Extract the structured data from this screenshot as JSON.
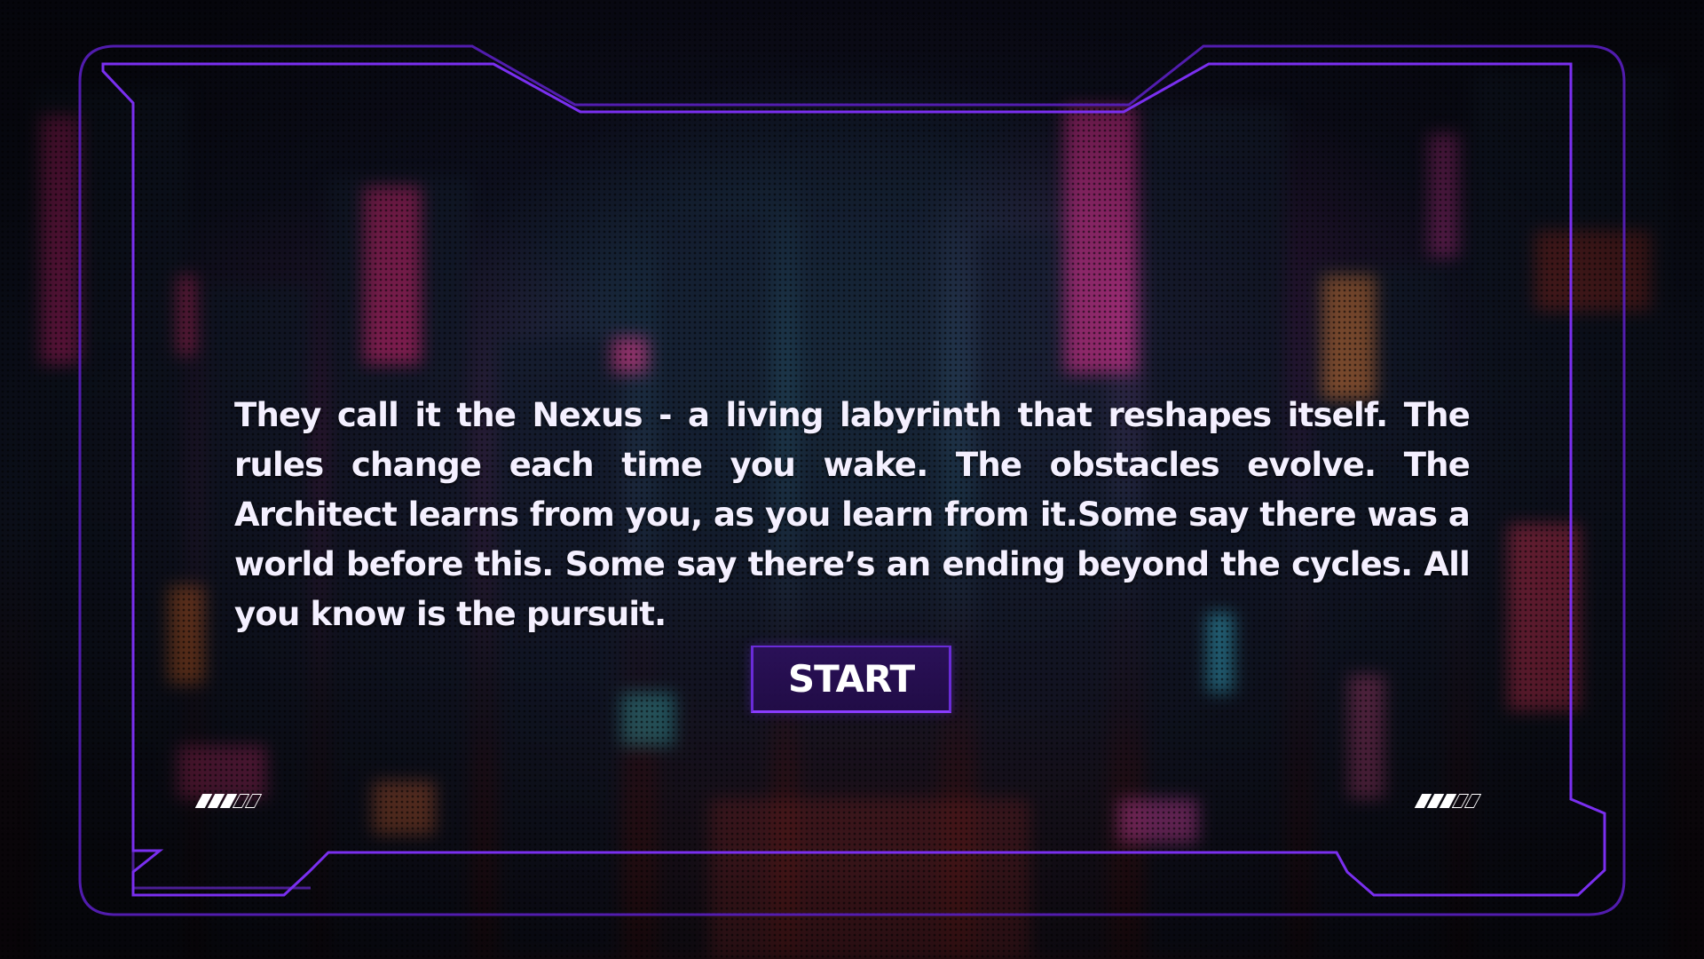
{
  "intro": {
    "story_text": "They call it the Nexus - a living labyrinth that reshapes itself. The rules change each time you wake. The obstacles evolve. The Architect learns from you, as you learn from it.Some say there was a world before this. Some say there’s an ending beyond the cycles. All you know is the pursuit.",
    "start_label": "START"
  },
  "indicators": {
    "left": {
      "filled": 3,
      "total": 5
    },
    "right": {
      "filled": 3,
      "total": 5
    }
  },
  "colors": {
    "frame_accent": "#7a2ff0",
    "button_fill": "#2c105c",
    "text": "#f4f0ff"
  }
}
